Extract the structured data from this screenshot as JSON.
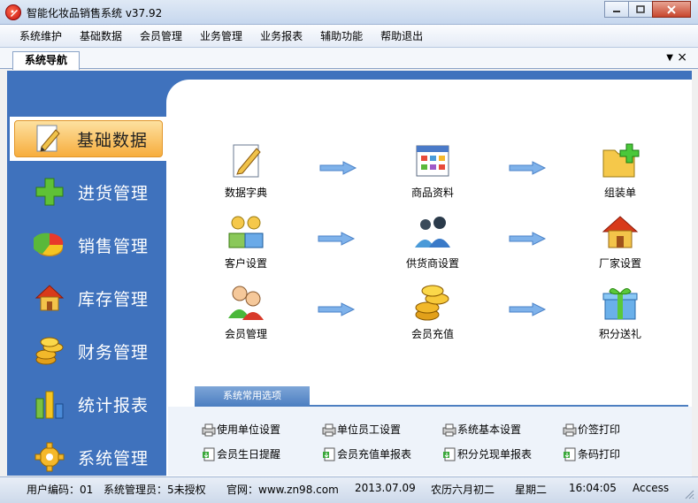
{
  "window": {
    "title": "智能化妆品销售系统 v37.92",
    "min": "0",
    "max": "1",
    "close": "r"
  },
  "menu": [
    "系统维护",
    "基础数据",
    "会员管理",
    "业务管理",
    "业务报表",
    "辅助功能",
    "帮助退出"
  ],
  "tab": {
    "label": "系统导航"
  },
  "sidebar": [
    {
      "label": "基础数据",
      "icon": "pencil-doc-icon",
      "active": true
    },
    {
      "label": "进货管理",
      "icon": "green-plus-icon"
    },
    {
      "label": "销售管理",
      "icon": "pie-chart-icon"
    },
    {
      "label": "库存管理",
      "icon": "house-icon"
    },
    {
      "label": "财务管理",
      "icon": "coins-icon"
    },
    {
      "label": "统计报表",
      "icon": "bar-chart-icon"
    },
    {
      "label": "系统管理",
      "icon": "gear-icon"
    }
  ],
  "features": [
    {
      "label": "数据字典",
      "icon": "pencil-doc-icon"
    },
    {
      "label": "商品资料",
      "icon": "grid-calendar-icon"
    },
    {
      "label": "组装单",
      "icon": "folder-add-icon"
    },
    {
      "label": "客户设置",
      "icon": "users-icon"
    },
    {
      "label": "供货商设置",
      "icon": "group-icon"
    },
    {
      "label": "厂家设置",
      "icon": "house-icon"
    },
    {
      "label": "会员管理",
      "icon": "members-icon"
    },
    {
      "label": "会员充值",
      "icon": "coins-icon"
    },
    {
      "label": "积分送礼",
      "icon": "gift-icon"
    }
  ],
  "options_section": "系统常用选项",
  "options": [
    {
      "label": "使用单位设置"
    },
    {
      "label": "单位员工设置"
    },
    {
      "label": "系统基本设置"
    },
    {
      "label": "价签打印"
    },
    {
      "label": "会员生日提醒"
    },
    {
      "label": "会员充值单报表"
    },
    {
      "label": "积分兑现单报表"
    },
    {
      "label": "条码打印"
    }
  ],
  "status": {
    "user_code": "用户编码：01",
    "user_name": "系统管理员：",
    "license": "5未授权",
    "website": "官网：www.zn98.com",
    "date": "2013.07.09",
    "lunar": "农历六月初二",
    "weekday": "星期二",
    "time": "16:04:05",
    "db": "Access"
  }
}
